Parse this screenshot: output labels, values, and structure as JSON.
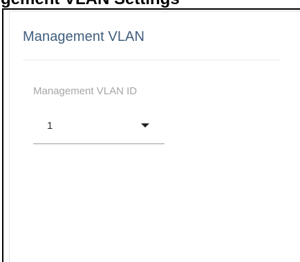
{
  "page": {
    "partial_heading": "gement VLAN Settings"
  },
  "panel": {
    "title": "Management VLAN",
    "field": {
      "label": "Management VLAN ID",
      "selected_value": "1",
      "icon": "caret-down-icon"
    }
  },
  "colors": {
    "title": "#3f5d7d",
    "label": "#a6a6a6",
    "value": "#333333",
    "frame": "#000000"
  }
}
